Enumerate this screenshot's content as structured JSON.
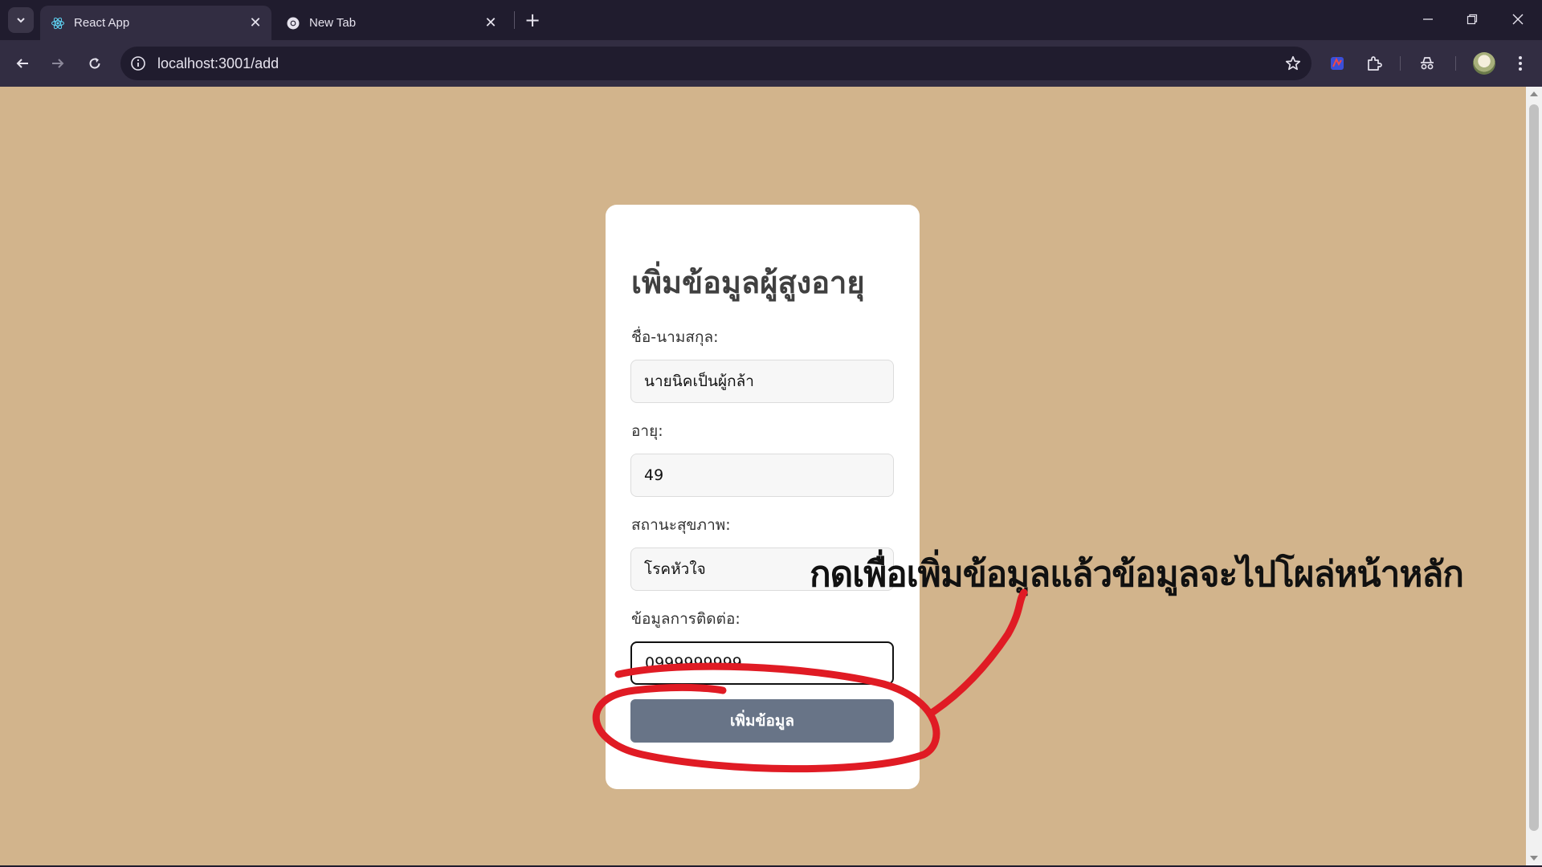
{
  "browser": {
    "tabs": [
      {
        "title": "React App",
        "active": true,
        "icon": "react-icon"
      },
      {
        "title": "New Tab",
        "active": false,
        "icon": "chrome-icon"
      }
    ],
    "url": "localhost:3001/add"
  },
  "form": {
    "title": "เพิ่มข้อมูลผู้สูงอายุ",
    "name_label": "ชื่อ-นามสกุล:",
    "name_value": "นายนิคเป็นผู้กล้า",
    "age_label": "อายุ:",
    "age_value": "49",
    "health_label": "สถานะสุขภาพ:",
    "health_value": "โรคหัวใจ",
    "contact_label": "ข้อมูลการติดต่อ:",
    "contact_value": "0999999999",
    "submit_label": "เพิ่มข้อมูล"
  },
  "annotation": {
    "text": "กดเพื่อเพิ่มข้อมูลแล้วข้อมูลจะไปโผล่หน้าหลัก",
    "color": "#e01b24"
  },
  "colors": {
    "page_background": "#d2b48c",
    "button": "#687487",
    "chrome_dark": "#201c2e"
  }
}
